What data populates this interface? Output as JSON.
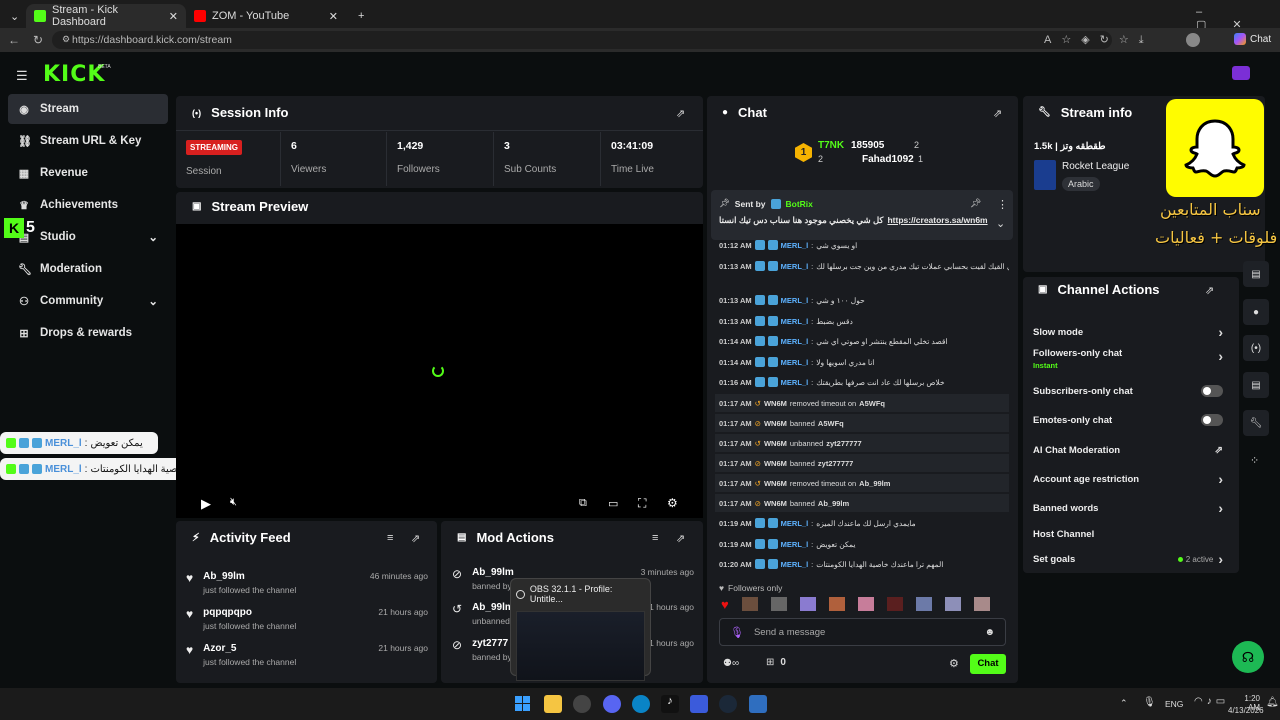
{
  "browser": {
    "tabs": [
      {
        "label": "Stream - Kick Dashboard"
      },
      {
        "label": "ZOM - YouTube"
      }
    ],
    "url": "https://dashboard.kick.com/stream",
    "chat_button": "Chat"
  },
  "brand": {
    "logo": "KICK",
    "beta": "BETA",
    "accent": "#53fc18"
  },
  "sidebar": {
    "items": [
      {
        "label": "Stream",
        "icon": "broadcast-icon"
      },
      {
        "label": "Stream URL & Key",
        "icon": "link-icon"
      },
      {
        "label": "Revenue",
        "icon": "chart-icon"
      },
      {
        "label": "Achievements",
        "icon": "trophy-icon"
      },
      {
        "label": "Studio",
        "icon": "studio-icon"
      },
      {
        "label": "Moderation",
        "icon": "wrench-icon"
      },
      {
        "label": "Community",
        "icon": "community-icon"
      },
      {
        "label": "Drops & rewards",
        "icon": "gift-icon"
      }
    ]
  },
  "session": {
    "title": "Session Info",
    "status": "STREAMING",
    "status_label": "Session",
    "stats": [
      {
        "value": "6",
        "label": "Viewers"
      },
      {
        "value": "1,429",
        "label": "Followers"
      },
      {
        "value": "3",
        "label": "Sub Counts"
      },
      {
        "value": "03:41:09",
        "label": "Time Live"
      }
    ]
  },
  "preview": {
    "title": "Stream Preview"
  },
  "activity": {
    "title": "Activity Feed",
    "items": [
      {
        "name": "Ab_99lm",
        "text": "just followed the channel",
        "time": "46 minutes ago"
      },
      {
        "name": "pqpqpqpo",
        "text": "just followed the channel",
        "time": "21 hours ago"
      },
      {
        "name": "Azor_5",
        "text": "just followed the channel",
        "time": "21 hours ago"
      }
    ]
  },
  "mod_actions": {
    "title": "Mod Actions",
    "items": [
      {
        "name": "Ab_99lm",
        "text": "banned by",
        "time": "3 minutes ago"
      },
      {
        "name": "Ab_99lm",
        "text": "unbanned",
        "time": "21 hours ago"
      },
      {
        "name": "zyt2777",
        "text": "banned by",
        "time": "21 hours ago"
      }
    ]
  },
  "obs_popup": {
    "title": "OBS 32.1.1 - Profile: Untitle..."
  },
  "chat": {
    "title": "Chat",
    "leaders": [
      {
        "name": "T7NK",
        "count": "2",
        "rank": "1"
      },
      {
        "name": "185905",
        "count": "2"
      },
      {
        "name": "Fahad1092",
        "count": "1"
      }
    ],
    "pinned": {
      "sent_by": "Sent by",
      "bot": "BotRix",
      "text": "كل شي يخصني موجود هنا سناب دس تيك انستا",
      "link": "https://creators.sa/wn6m"
    },
    "messages": [
      {
        "time": "01:12 AM",
        "user": "MERL_l",
        "text": "او يسوي شي"
      },
      {
        "time": "01:13 AM",
        "user": "MERL_l",
        "text": "في القيك لقيت بحسابي عملات تيك مدري من وين جت برسلها لك"
      },
      {
        "time": "01:13 AM",
        "user": "MERL_l",
        "text": "حول ١٠٠ و شي"
      },
      {
        "time": "01:13 AM",
        "user": "MERL_l",
        "text": "دقس بضبط"
      },
      {
        "time": "01:14 AM",
        "user": "MERL_l",
        "text": "اقصد تخلي المقطع ينتشر او صوتي اي شي"
      },
      {
        "time": "01:14 AM",
        "user": "MERL_l",
        "text": "انا مدري اسويها ولا"
      },
      {
        "time": "01:16 AM",
        "user": "MERL_l",
        "text": "خلاص برسلها لك عاد انت صرفها بطريقتك"
      }
    ],
    "mod_events": [
      {
        "time": "01:17 AM",
        "actor": "WN6M",
        "action": "removed timeout on",
        "target": "A5WFq"
      },
      {
        "time": "01:17 AM",
        "actor": "WN6M",
        "action": "banned",
        "target": "A5WFq"
      },
      {
        "time": "01:17 AM",
        "actor": "WN6M",
        "action": "unbanned",
        "target": "zyt277777"
      },
      {
        "time": "01:17 AM",
        "actor": "WN6M",
        "action": "banned",
        "target": "zyt277777"
      },
      {
        "time": "01:17 AM",
        "actor": "WN6M",
        "action": "removed timeout on",
        "target": "Ab_99lm"
      },
      {
        "time": "01:17 AM",
        "actor": "WN6M",
        "action": "banned",
        "target": "Ab_99lm"
      }
    ],
    "late_messages": [
      {
        "time": "01:19 AM",
        "user": "MERL_l",
        "text": "مايمدي ارسل لك ماعندك الميزه"
      },
      {
        "time": "01:19 AM",
        "user": "MERL_l",
        "text": "يمكن تعويض"
      },
      {
        "time": "01:20 AM",
        "user": "MERL_l",
        "text": "المهم ترا ماعندك خاصية الهدايا الكومنتات"
      }
    ],
    "followers_only": "Followers only",
    "input_placeholder": "Send a message",
    "points": "0",
    "send": "Chat"
  },
  "stream_info": {
    "title": "Stream info",
    "stream_title": "1.5k | طقطقه وتز",
    "category": "Rocket League",
    "language": "Arabic"
  },
  "snap_overlay": {
    "line1": "سناب المتابعين",
    "line2": "فلوقات + فعاليات"
  },
  "kick_overlay": {
    "count": "5"
  },
  "overlay_chat": [
    {
      "user": "MERL_l",
      "text": "يمكن تعويض"
    },
    {
      "user": "MERL_l",
      "text": "المهم ترا ماعندك خاصية الهدايا الكومنتات"
    }
  ],
  "channel_actions": {
    "title": "Channel Actions",
    "items": [
      {
        "label": "Slow mode",
        "type": "chevron"
      },
      {
        "label": "Followers-only chat",
        "sub": "Instant",
        "type": "chevron"
      },
      {
        "label": "Subscribers-only chat",
        "type": "toggle"
      },
      {
        "label": "Emotes-only chat",
        "type": "toggle"
      },
      {
        "label": "AI Chat Moderation",
        "type": "external"
      },
      {
        "label": "Account age restriction",
        "type": "chevron"
      },
      {
        "label": "Banned words",
        "type": "chevron"
      },
      {
        "label": "Host Channel",
        "type": "none"
      },
      {
        "label": "Set goals",
        "extra": "2 active",
        "type": "chevron"
      }
    ]
  },
  "taskbar": {
    "lang": "ENG",
    "time": "1:20 AM",
    "date": "4/13/2026"
  }
}
